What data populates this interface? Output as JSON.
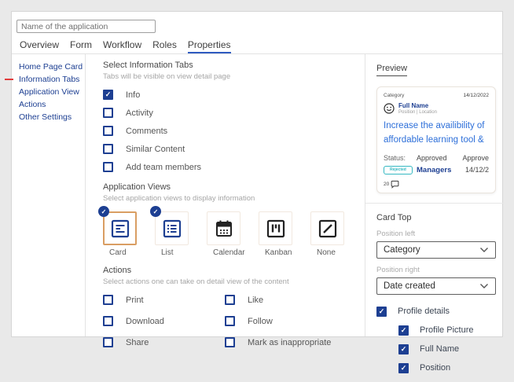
{
  "header": {
    "name_placeholder": "Name of the application"
  },
  "tabs": {
    "items": [
      {
        "label": "Overview",
        "active": false
      },
      {
        "label": "Form",
        "active": false
      },
      {
        "label": "Workflow",
        "active": false
      },
      {
        "label": "Roles",
        "active": false
      },
      {
        "label": "Properties",
        "active": true
      }
    ]
  },
  "sidebar": {
    "items": [
      {
        "label": "Home Page Card",
        "active": false
      },
      {
        "label": "Information Tabs",
        "active": true
      },
      {
        "label": "Application View",
        "active": false
      },
      {
        "label": "Actions",
        "active": false
      },
      {
        "label": "Other Settings",
        "active": false
      }
    ]
  },
  "info_tabs": {
    "title": "Select Information Tabs",
    "subtitle": "Tabs will be visible on view detail page",
    "options": [
      {
        "label": "Info",
        "checked": true
      },
      {
        "label": "Activity",
        "checked": false
      },
      {
        "label": "Comments",
        "checked": false
      },
      {
        "label": "Similar Content",
        "checked": false
      },
      {
        "label": "Add team members",
        "checked": false
      }
    ]
  },
  "views": {
    "title": "Application Views",
    "subtitle": "Select application views to display information",
    "tiles": [
      {
        "label": "Card",
        "selected": true
      },
      {
        "label": "List",
        "selected": true
      },
      {
        "label": "Calendar",
        "selected": false
      },
      {
        "label": "Kanban",
        "selected": false
      },
      {
        "label": "None",
        "selected": false
      }
    ]
  },
  "actions": {
    "title": "Actions",
    "subtitle": "Select actions one can take on detail view of the content",
    "col1": [
      {
        "label": "Print",
        "checked": false
      },
      {
        "label": "Download",
        "checked": false
      },
      {
        "label": "Share",
        "checked": false
      }
    ],
    "col2": [
      {
        "label": "Like",
        "checked": false
      },
      {
        "label": "Follow",
        "checked": false
      },
      {
        "label": "Mark as inappropriate",
        "checked": false
      }
    ]
  },
  "preview": {
    "label": "Preview",
    "card": {
      "category": "Category",
      "date": "14/12/2022",
      "full_name": "Full Name",
      "position_location": "Position | Location",
      "title": "Increase the availibility of affordable learning tool &",
      "status_label": "Status:",
      "status_value": "Approved",
      "approve_label": "Approve",
      "badge": "Rejected",
      "managers": "Managers",
      "approve_date": "14/12/2",
      "comments_count": "20"
    }
  },
  "card_top": {
    "title": "Card Top",
    "position_left_label": "Position left",
    "position_left_value": "Category",
    "position_right_label": "Position right",
    "position_right_value": "Date created",
    "profile": {
      "label": "Profile details",
      "checked": true,
      "children": [
        {
          "label": "Profile Picture",
          "checked": true
        },
        {
          "label": "Full Name",
          "checked": true
        },
        {
          "label": "Position",
          "checked": true
        }
      ]
    }
  },
  "icons": {
    "check": "✓"
  },
  "colors": {
    "accent_blue": "#1d3f92",
    "link_blue": "#2d6fd9",
    "tab_underline": "#2f5bc0",
    "active_marker_red": "#e23b3b",
    "badge_teal": "#35b8c2",
    "selected_tile_orange": "#d99e63",
    "page_background": "#e9e9e9"
  }
}
